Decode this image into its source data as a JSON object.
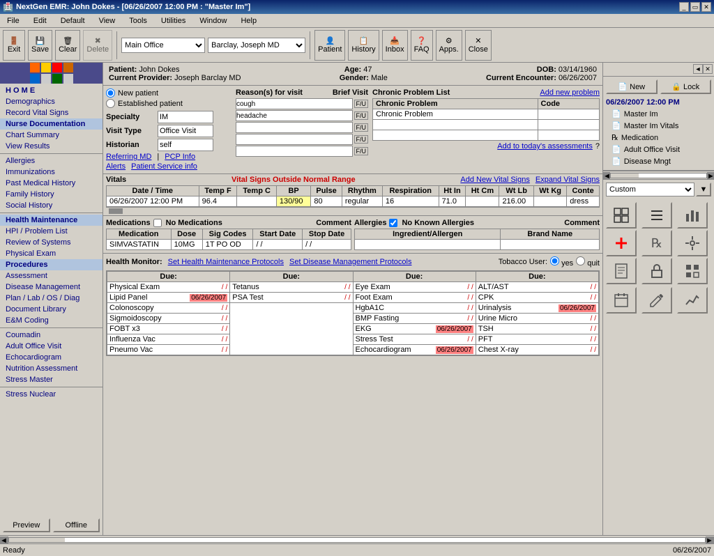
{
  "window": {
    "title": "NextGen EMR: John Dokes - [06/26/2007 12:00 PM : \"Master Im\"]",
    "title_icon": "emr-icon"
  },
  "menubar": {
    "items": [
      "File",
      "Edit",
      "Default",
      "View",
      "Tools",
      "Utilities",
      "Window",
      "Help"
    ]
  },
  "toolbar": {
    "location": "Main Office",
    "provider": "Barclay, Joseph  MD",
    "buttons": [
      "Exit",
      "Save",
      "Clear",
      "Delete",
      "Patient",
      "History",
      "Inbox",
      "FAQ",
      "Apps.",
      "Close"
    ]
  },
  "patient": {
    "name": "John Dokes",
    "age_label": "Age:",
    "age": "47",
    "dob_label": "DOB:",
    "dob": "03/14/1960",
    "provider_label": "Current Provider:",
    "provider": "Joseph Barclay MD",
    "gender_label": "Gender:",
    "gender": "Male",
    "encounter_label": "Current Encounter:",
    "encounter": "06/26/2007"
  },
  "visit": {
    "new_patient_label": "New patient",
    "established_label": "Established patient",
    "specialty_label": "Specialty",
    "specialty": "IM",
    "visit_type_label": "Visit Type",
    "visit_type": "Office Visit",
    "historian_label": "Historian",
    "historian": "self",
    "referring_md": "Referring MD",
    "pcp_info": "PCP Info",
    "alerts": "Alerts",
    "patient_service": "Patient Service info"
  },
  "reasons": {
    "title": "Reason(s) for visit",
    "brief_visit": "Brief Visit",
    "items": [
      {
        "text": "cough",
        "fu": "F/U"
      },
      {
        "text": "headache",
        "fu": "F/U"
      },
      {
        "text": "",
        "fu": "F/U"
      },
      {
        "text": "",
        "fu": "F/U"
      },
      {
        "text": "",
        "fu": "F/U"
      }
    ]
  },
  "chronic": {
    "title": "Chronic Problem List",
    "add_link": "Add new problem",
    "columns": [
      "Chronic Problem",
      "Code"
    ],
    "items": [
      {
        "problem": "Chronic Problem",
        "code": ""
      }
    ],
    "add_assessments": "Add to today's assessments",
    "help": "?"
  },
  "vitals": {
    "title": "Vitals",
    "warning": "Vital Signs Outside Normal Range",
    "add_link": "Add New Vital Signs",
    "expand_link": "Expand Vital Signs",
    "columns": [
      "Date / Time",
      "Temp F",
      "Temp C",
      "BP",
      "Pulse",
      "Rhythm",
      "Respiration",
      "Ht In",
      "Ht Cm",
      "Wt Lb",
      "Wt Kg",
      "Conte"
    ],
    "rows": [
      [
        "06/26/2007 12:00 PM",
        "96.4",
        "",
        "130/90",
        "80",
        "regular",
        "16",
        "71.0",
        "",
        "216.00",
        "",
        "dress"
      ]
    ]
  },
  "medications": {
    "title": "Medications",
    "no_meds_label": "No Medications",
    "comment_label": "Comment",
    "columns": [
      "Medication",
      "Dose",
      "Sig Codes",
      "Start Date",
      "Stop Date"
    ],
    "rows": [
      [
        "SIMVASTATIN",
        "10MG",
        "1T PO OD",
        "/ /",
        "/ /"
      ]
    ]
  },
  "allergies": {
    "title": "Allergies",
    "no_known_label": "No Known Allergies",
    "comment_label": "Comment",
    "columns": [
      "Ingredient/Allergen",
      "Brand Name"
    ],
    "rows": []
  },
  "health_monitor": {
    "title": "Health Monitor:",
    "set_hm_link": "Set Health Maintenance Protocols",
    "set_dm_link": "Set Disease Management Protocols",
    "tobacco_label": "Tobacco User:",
    "tobacco_yes": "yes",
    "tobacco_quit": "quit",
    "due_label": "Due:",
    "items_col1": [
      {
        "label": "Physical Exam",
        "date": "/ /",
        "highlight": false
      },
      {
        "label": "Lipid Panel",
        "date": "06/26/2007",
        "highlight": true
      },
      {
        "label": "Colonoscopy",
        "date": "/ /",
        "highlight": false
      },
      {
        "label": "Sigmoidoscopy",
        "date": "/ /",
        "highlight": false
      },
      {
        "label": "FOBT x3",
        "date": "/ /",
        "highlight": false
      },
      {
        "label": "Influenza Vac",
        "date": "/ /",
        "highlight": false
      },
      {
        "label": "Pneumo Vac",
        "date": "/ /",
        "highlight": false
      }
    ],
    "items_col2": [
      {
        "label": "Tetanus",
        "date": "/ /",
        "highlight": false
      },
      {
        "label": "PSA Test",
        "date": "/ /",
        "highlight": false
      }
    ],
    "items_col3": [
      {
        "label": "Eye Exam",
        "date": "/ /",
        "highlight": false
      },
      {
        "label": "Foot Exam",
        "date": "/ /",
        "highlight": false
      },
      {
        "label": "HgbA1C",
        "date": "/ /",
        "highlight": false
      },
      {
        "label": "BMP Fasting",
        "date": "/ /",
        "highlight": false
      },
      {
        "label": "EKG",
        "date": "06/26/2007",
        "highlight": true
      },
      {
        "label": "Stress Test",
        "date": "/ /",
        "highlight": false
      },
      {
        "label": "Echocardiogram",
        "date": "06/26/2007",
        "highlight": true
      }
    ],
    "items_col4": [
      {
        "label": "ALT/AST",
        "date": "/ /",
        "highlight": false
      },
      {
        "label": "CPK",
        "date": "/ /",
        "highlight": false
      },
      {
        "label": "Urinalysis",
        "date": "06/26/2007",
        "highlight": true
      },
      {
        "label": "Urine Micro",
        "date": "/ /",
        "highlight": false
      },
      {
        "label": "TSH",
        "date": "/ /",
        "highlight": false
      },
      {
        "label": "PFT",
        "date": "/ /",
        "highlight": false
      },
      {
        "label": "Chest X-ray",
        "date": "/ /",
        "highlight": false
      }
    ]
  },
  "sidebar": {
    "items": [
      {
        "label": "H O M E",
        "bold": true
      },
      {
        "label": "Demographics"
      },
      {
        "label": "Record Vital Signs"
      },
      {
        "label": "Nurse Documentation",
        "active": true
      },
      {
        "label": "Chart Summary"
      },
      {
        "label": "View Results"
      },
      {
        "separator": true
      },
      {
        "label": "Allergies"
      },
      {
        "label": "Immunizations"
      },
      {
        "label": "Past Medical History"
      },
      {
        "label": "Family History"
      },
      {
        "label": "Social History"
      },
      {
        "separator": true
      },
      {
        "label": "Health Maintenance",
        "active": true
      },
      {
        "label": "HPI / Problem List"
      },
      {
        "label": "Review of Systems"
      },
      {
        "label": "Physical Exam"
      },
      {
        "label": "Procedures",
        "active": true
      },
      {
        "label": "Assessment"
      },
      {
        "label": "Disease Management"
      },
      {
        "label": "Plan / Lab / OS / Diag"
      },
      {
        "label": "Document Library"
      },
      {
        "label": "E&M Coding"
      },
      {
        "separator": true
      },
      {
        "label": "Coumadin"
      },
      {
        "label": "Adult Office Visit"
      },
      {
        "label": "Echocardiogram"
      },
      {
        "label": "Nutrition Assessment"
      },
      {
        "label": "Stress Master"
      },
      {
        "separator": true
      },
      {
        "label": "Stress Nuclear"
      }
    ],
    "preview_btn": "Preview",
    "offline_btn": "Offline"
  },
  "right_panel": {
    "new_btn": "New",
    "lock_btn": "Lock",
    "date": "06/26/2007 12:00 PM",
    "tree_items": [
      {
        "label": "Master Im",
        "icon": "document-icon"
      },
      {
        "label": "Master Im Vitals",
        "icon": "document-icon"
      },
      {
        "label": "Medication",
        "icon": "rx-icon"
      },
      {
        "label": "Adult Office Visit",
        "icon": "document-icon"
      },
      {
        "label": "Disease Mngt",
        "icon": "document-icon"
      }
    ],
    "custom_label": "Custom",
    "icon_buttons": [
      "grid-icon",
      "list-icon",
      "chart-icon",
      "plus-icon",
      "rx-icon",
      "tools-icon",
      "report-icon",
      "lock-icon",
      "grid2-icon"
    ]
  },
  "statusbar": {
    "status": "Ready",
    "date": "06/26/2007"
  }
}
